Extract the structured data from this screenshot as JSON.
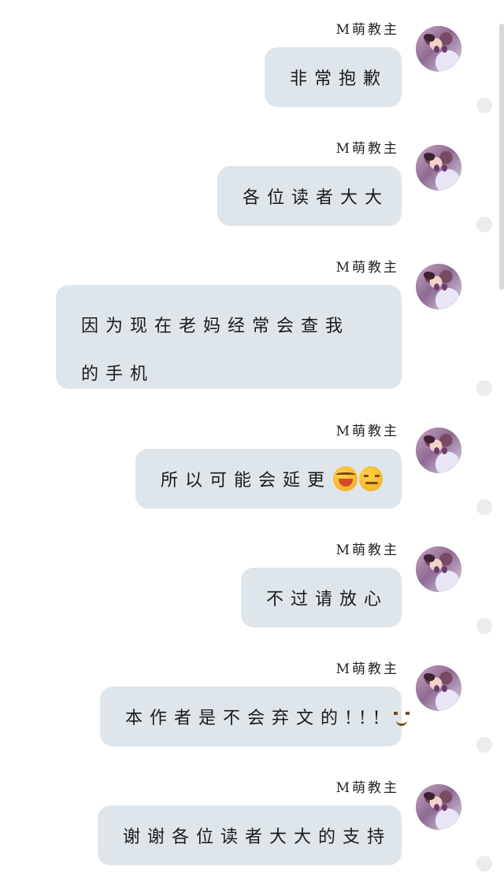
{
  "chat": {
    "messages": [
      {
        "sender": "M萌教主",
        "text": "非常抱歉"
      },
      {
        "sender": "M萌教主",
        "text": "各位读者大大"
      },
      {
        "sender": "M萌教主",
        "text": "因为现在老妈经常会查我的手机"
      },
      {
        "sender": "M萌教主",
        "text": "所以可能会延更"
      },
      {
        "sender": "M萌教主",
        "text": "不过请放心"
      },
      {
        "sender": "M萌教主",
        "text": "本作者是不会弃文的!!!"
      },
      {
        "sender": "M萌教主",
        "text": "谢谢各位读者大大的支持"
      }
    ]
  },
  "icons": {
    "avatar": "girl-avatar",
    "emoji_1": "crying-face-icon",
    "emoji_2": "sad-face-icon",
    "emoji_3": "wink-face-icon"
  },
  "colors": {
    "bubble": "#dfe6eb",
    "background": "#ffffff",
    "dot": "#ececec"
  }
}
